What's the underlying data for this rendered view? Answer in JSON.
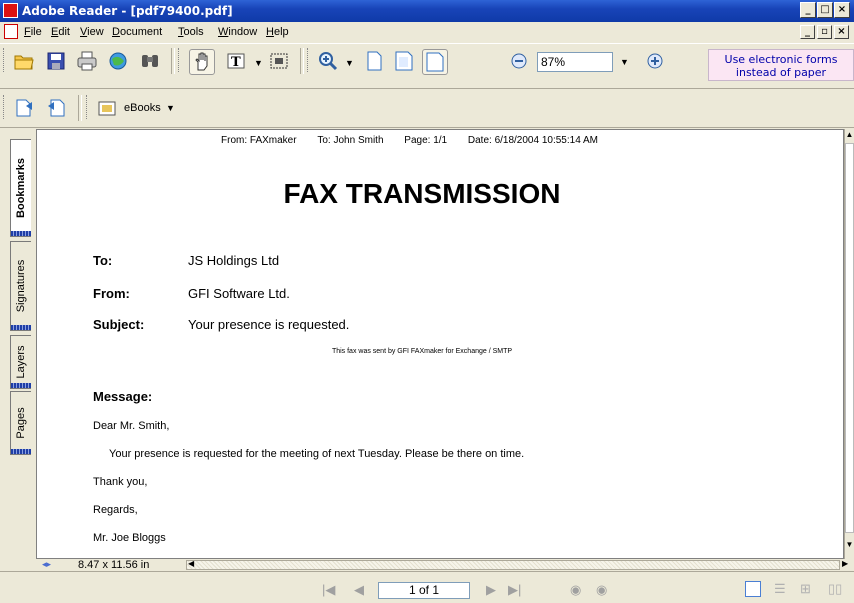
{
  "window": {
    "title": "Adobe Reader - [pdf79400.pdf]"
  },
  "menu": {
    "items": [
      {
        "u": "F",
        "rest": "ile"
      },
      {
        "u": "E",
        "rest": "dit"
      },
      {
        "u": "V",
        "rest": "iew"
      },
      {
        "u": "D",
        "rest": "ocument"
      },
      {
        "u": "T",
        "rest": "ools"
      },
      {
        "u": "W",
        "rest": "indow"
      },
      {
        "u": "H",
        "rest": "elp"
      }
    ]
  },
  "toolbar": {
    "zoom_value": "87%",
    "electronic_forms_line1": "Use electronic forms",
    "electronic_forms_line2": "instead of paper",
    "ebooks_label": "eBooks"
  },
  "nav_tabs": [
    "Bookmarks",
    "Signatures",
    "Layers",
    "Pages"
  ],
  "fax": {
    "header_from": "From: FAXmaker",
    "header_to": "To: John Smith",
    "header_page": "Page: 1/1",
    "header_date": "Date: 6/18/2004 10:55:14 AM",
    "title": "FAX TRANSMISSION",
    "to_label": "To:",
    "to_value": "JS Holdings Ltd",
    "from_label": "From:",
    "from_value": "GFI Software Ltd.",
    "subject_label": "Subject:",
    "subject_value": "Your presence is requested.",
    "sent_note": "This fax was sent by GFI FAXmaker for Exchange / SMTP",
    "message_label": "Message:",
    "lines": [
      "Dear Mr. Smith,",
      "Your presence is requested for the meeting of next Tuesday. Please be there on time.",
      "Thank you,",
      "Regards,",
      "Mr. Joe Bloggs"
    ]
  },
  "status": {
    "page_size": "8.47 x 11.56 in"
  },
  "navigation": {
    "page_indicator": "1 of 1"
  }
}
